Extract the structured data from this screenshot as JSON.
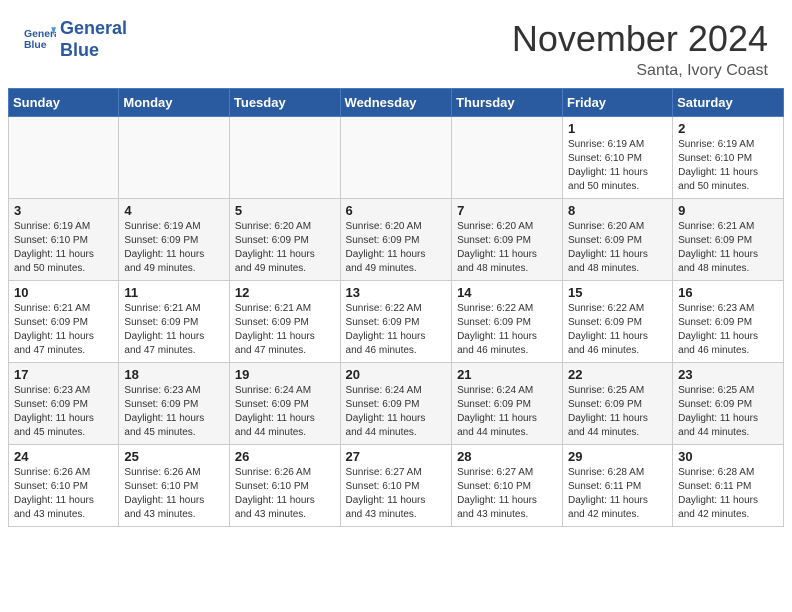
{
  "header": {
    "logo_line1": "General",
    "logo_line2": "Blue",
    "month_year": "November 2024",
    "location": "Santa, Ivory Coast"
  },
  "weekdays": [
    "Sunday",
    "Monday",
    "Tuesday",
    "Wednesday",
    "Thursday",
    "Friday",
    "Saturday"
  ],
  "weeks": [
    [
      {
        "day": "",
        "info": ""
      },
      {
        "day": "",
        "info": ""
      },
      {
        "day": "",
        "info": ""
      },
      {
        "day": "",
        "info": ""
      },
      {
        "day": "",
        "info": ""
      },
      {
        "day": "1",
        "info": "Sunrise: 6:19 AM\nSunset: 6:10 PM\nDaylight: 11 hours\nand 50 minutes."
      },
      {
        "day": "2",
        "info": "Sunrise: 6:19 AM\nSunset: 6:10 PM\nDaylight: 11 hours\nand 50 minutes."
      }
    ],
    [
      {
        "day": "3",
        "info": "Sunrise: 6:19 AM\nSunset: 6:10 PM\nDaylight: 11 hours\nand 50 minutes."
      },
      {
        "day": "4",
        "info": "Sunrise: 6:19 AM\nSunset: 6:09 PM\nDaylight: 11 hours\nand 49 minutes."
      },
      {
        "day": "5",
        "info": "Sunrise: 6:20 AM\nSunset: 6:09 PM\nDaylight: 11 hours\nand 49 minutes."
      },
      {
        "day": "6",
        "info": "Sunrise: 6:20 AM\nSunset: 6:09 PM\nDaylight: 11 hours\nand 49 minutes."
      },
      {
        "day": "7",
        "info": "Sunrise: 6:20 AM\nSunset: 6:09 PM\nDaylight: 11 hours\nand 48 minutes."
      },
      {
        "day": "8",
        "info": "Sunrise: 6:20 AM\nSunset: 6:09 PM\nDaylight: 11 hours\nand 48 minutes."
      },
      {
        "day": "9",
        "info": "Sunrise: 6:21 AM\nSunset: 6:09 PM\nDaylight: 11 hours\nand 48 minutes."
      }
    ],
    [
      {
        "day": "10",
        "info": "Sunrise: 6:21 AM\nSunset: 6:09 PM\nDaylight: 11 hours\nand 47 minutes."
      },
      {
        "day": "11",
        "info": "Sunrise: 6:21 AM\nSunset: 6:09 PM\nDaylight: 11 hours\nand 47 minutes."
      },
      {
        "day": "12",
        "info": "Sunrise: 6:21 AM\nSunset: 6:09 PM\nDaylight: 11 hours\nand 47 minutes."
      },
      {
        "day": "13",
        "info": "Sunrise: 6:22 AM\nSunset: 6:09 PM\nDaylight: 11 hours\nand 46 minutes."
      },
      {
        "day": "14",
        "info": "Sunrise: 6:22 AM\nSunset: 6:09 PM\nDaylight: 11 hours\nand 46 minutes."
      },
      {
        "day": "15",
        "info": "Sunrise: 6:22 AM\nSunset: 6:09 PM\nDaylight: 11 hours\nand 46 minutes."
      },
      {
        "day": "16",
        "info": "Sunrise: 6:23 AM\nSunset: 6:09 PM\nDaylight: 11 hours\nand 46 minutes."
      }
    ],
    [
      {
        "day": "17",
        "info": "Sunrise: 6:23 AM\nSunset: 6:09 PM\nDaylight: 11 hours\nand 45 minutes."
      },
      {
        "day": "18",
        "info": "Sunrise: 6:23 AM\nSunset: 6:09 PM\nDaylight: 11 hours\nand 45 minutes."
      },
      {
        "day": "19",
        "info": "Sunrise: 6:24 AM\nSunset: 6:09 PM\nDaylight: 11 hours\nand 44 minutes."
      },
      {
        "day": "20",
        "info": "Sunrise: 6:24 AM\nSunset: 6:09 PM\nDaylight: 11 hours\nand 44 minutes."
      },
      {
        "day": "21",
        "info": "Sunrise: 6:24 AM\nSunset: 6:09 PM\nDaylight: 11 hours\nand 44 minutes."
      },
      {
        "day": "22",
        "info": "Sunrise: 6:25 AM\nSunset: 6:09 PM\nDaylight: 11 hours\nand 44 minutes."
      },
      {
        "day": "23",
        "info": "Sunrise: 6:25 AM\nSunset: 6:09 PM\nDaylight: 11 hours\nand 44 minutes."
      }
    ],
    [
      {
        "day": "24",
        "info": "Sunrise: 6:26 AM\nSunset: 6:10 PM\nDaylight: 11 hours\nand 43 minutes."
      },
      {
        "day": "25",
        "info": "Sunrise: 6:26 AM\nSunset: 6:10 PM\nDaylight: 11 hours\nand 43 minutes."
      },
      {
        "day": "26",
        "info": "Sunrise: 6:26 AM\nSunset: 6:10 PM\nDaylight: 11 hours\nand 43 minutes."
      },
      {
        "day": "27",
        "info": "Sunrise: 6:27 AM\nSunset: 6:10 PM\nDaylight: 11 hours\nand 43 minutes."
      },
      {
        "day": "28",
        "info": "Sunrise: 6:27 AM\nSunset: 6:10 PM\nDaylight: 11 hours\nand 43 minutes."
      },
      {
        "day": "29",
        "info": "Sunrise: 6:28 AM\nSunset: 6:11 PM\nDaylight: 11 hours\nand 42 minutes."
      },
      {
        "day": "30",
        "info": "Sunrise: 6:28 AM\nSunset: 6:11 PM\nDaylight: 11 hours\nand 42 minutes."
      }
    ]
  ]
}
